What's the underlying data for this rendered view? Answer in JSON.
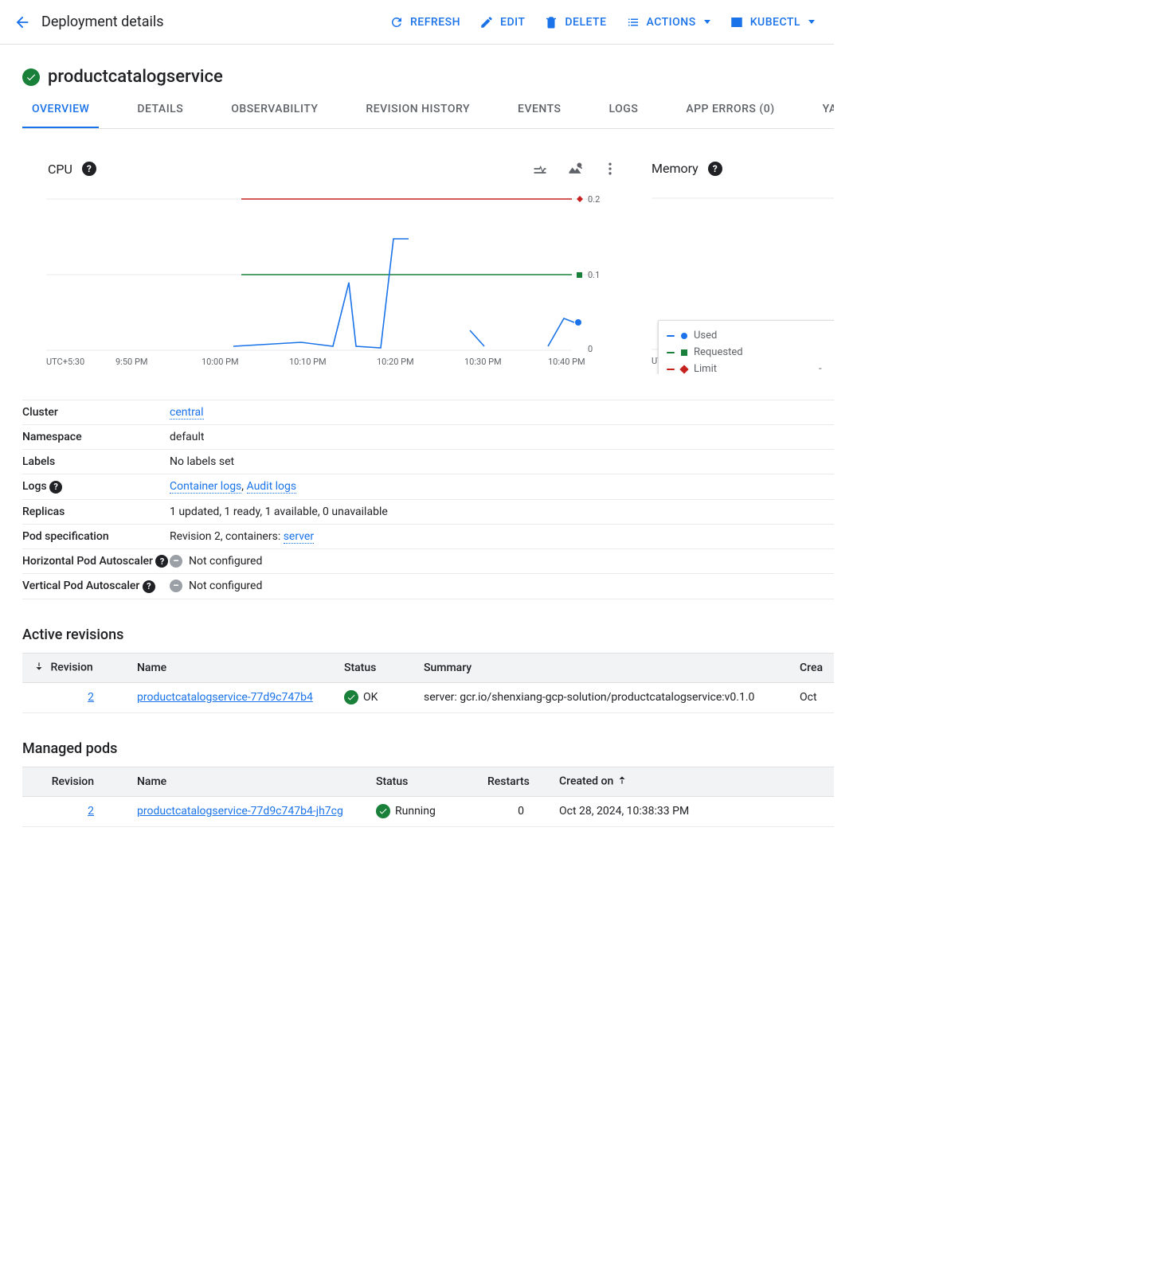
{
  "header": {
    "title": "Deployment details",
    "actions": {
      "refresh": "REFRESH",
      "edit": "EDIT",
      "delete": "DELETE",
      "actions": "ACTIONS",
      "kubectl": "KUBECTL"
    }
  },
  "deployment": {
    "name": "productcatalogservice",
    "status": "OK"
  },
  "tabs": {
    "overview": "OVERVIEW",
    "details": "DETAILS",
    "observability": "OBSERVABILITY",
    "revision_history": "REVISION HISTORY",
    "events": "EVENTS",
    "logs": "LOGS",
    "app_errors": "APP ERRORS (0)",
    "yaml": "YAML"
  },
  "charts": {
    "cpu": {
      "title": "CPU"
    },
    "memory": {
      "title": "Memory"
    },
    "legend": {
      "used": "Used",
      "requested": "Requested",
      "limit": "Limit"
    }
  },
  "chart_data": {
    "type": "line",
    "title": "CPU",
    "xlabel": "UTC+5:30",
    "ylabel": "",
    "ylim": [
      0,
      0.2
    ],
    "x_ticks": [
      "9:50 PM",
      "10:00 PM",
      "10:10 PM",
      "10:20 PM",
      "10:30 PM",
      "10:40 PM"
    ],
    "y_ticks": [
      0,
      0.1,
      0.2
    ],
    "series": [
      {
        "name": "Used",
        "color": "#1a73e8",
        "values": [
          {
            "x": "10:04 PM",
            "y": 0.005
          },
          {
            "x": "10:12 PM",
            "y": 0.01
          },
          {
            "x": "10:14 PM",
            "y": 0.005
          },
          {
            "x": "10:15 PM",
            "y": 0.09
          },
          {
            "x": "10:16 PM",
            "y": 0.005
          },
          {
            "x": "10:19 PM",
            "y": 0.005
          },
          {
            "x": "10:21 PM",
            "y": 0.15
          },
          {
            "x": "10:22 PM",
            "y": 0.15
          },
          {
            "x": "10:30 PM",
            "y": 0.03
          },
          {
            "x": "10:32 PM",
            "y": 0.005
          },
          {
            "x": "10:39 PM",
            "y": 0.005
          },
          {
            "x": "10:41 PM",
            "y": 0.04
          },
          {
            "x": "10:42 PM",
            "y": 0.04
          }
        ]
      },
      {
        "name": "Requested",
        "color": "#188038",
        "constant": 0.1,
        "x_range": [
          "10:04 PM",
          "10:42 PM"
        ]
      },
      {
        "name": "Limit",
        "color": "#c5221f",
        "constant": 0.2,
        "x_range": [
          "10:04 PM",
          "10:42 PM"
        ]
      }
    ]
  },
  "info": {
    "cluster": {
      "label": "Cluster",
      "link": "central"
    },
    "namespace": {
      "label": "Namespace",
      "value": "default"
    },
    "labels": {
      "label": "Labels",
      "value": "No labels set"
    },
    "logs": {
      "label": "Logs",
      "links": [
        "Container logs",
        "Audit logs"
      ]
    },
    "replicas": {
      "label": "Replicas",
      "value": "1 updated, 1 ready, 1 available, 0 unavailable"
    },
    "pod_spec": {
      "label": "Pod specification",
      "prefix": "Revision 2, containers: ",
      "link": "server"
    },
    "hpa": {
      "label": "Horizontal Pod Autoscaler",
      "value": "Not configured"
    },
    "vpa": {
      "label": "Vertical Pod Autoscaler",
      "value": "Not configured"
    }
  },
  "revisions": {
    "title": "Active revisions",
    "columns": {
      "revision": "Revision",
      "name": "Name",
      "status": "Status",
      "summary": "Summary",
      "created": "Crea"
    },
    "rows": [
      {
        "revision": "2",
        "name": "productcatalogservice-77d9c747b4",
        "status": "OK",
        "summary": "server: gcr.io/shenxiang-gcp-solution/productcatalogservice:v0.1.0",
        "created": "Oct"
      }
    ]
  },
  "pods": {
    "title": "Managed pods",
    "columns": {
      "revision": "Revision",
      "name": "Name",
      "status": "Status",
      "restarts": "Restarts",
      "created": "Created on"
    },
    "rows": [
      {
        "revision": "2",
        "name": "productcatalogservice-77d9c747b4-jh7cg",
        "status": "Running",
        "restarts": "0",
        "created": "Oct 28, 2024, 10:38:33 PM"
      }
    ]
  }
}
